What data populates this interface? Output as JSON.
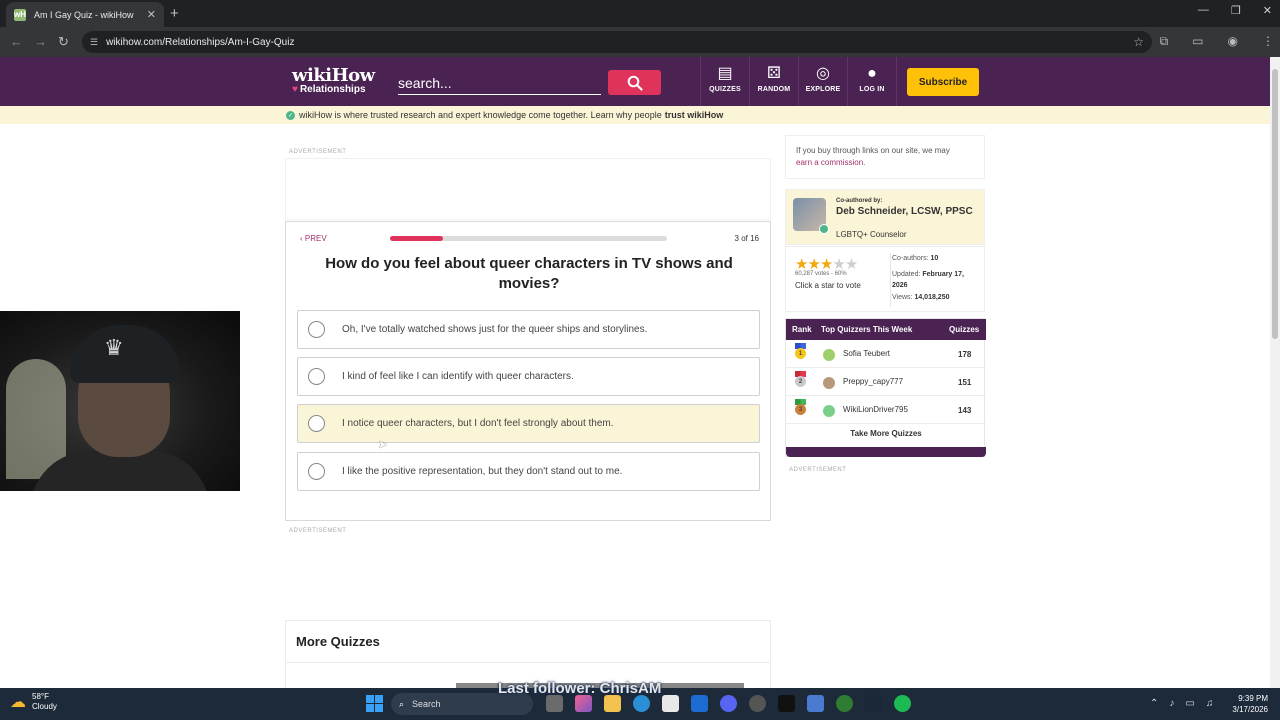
{
  "browser": {
    "tab_title": "Am I Gay Quiz - wikiHow",
    "tab_favicon": "wH",
    "url": "wikihow.com/Relationships/Am-I-Gay-Quiz"
  },
  "header": {
    "logo_main": "wikiHow",
    "logo_sub": "Relationships",
    "search_placeholder": "search...",
    "nav": [
      {
        "label": "QUIZZES",
        "icon": "quiz-icon"
      },
      {
        "label": "RANDOM",
        "icon": "dice-icon"
      },
      {
        "label": "EXPLORE",
        "icon": "compass-icon"
      },
      {
        "label": "LOG IN",
        "icon": "user-icon"
      }
    ],
    "subscribe": "Subscribe"
  },
  "trust_bar": {
    "text": "wikiHow is where trusted research and expert knowledge come together. Learn why people",
    "bold": "trust wikiHow"
  },
  "ads": {
    "label": "ADVERTISEMENT"
  },
  "quiz": {
    "prev": "PREV",
    "progress": 0.19,
    "count": "3 of 16",
    "question": "How do you feel about queer characters in TV shows and movies?",
    "options": [
      "Oh, I've totally watched shows just for the queer ships and storylines.",
      "I kind of feel like I can identify with queer characters.",
      "I notice queer characters, but I don't feel strongly about them.",
      "I like the positive representation, but they don't stand out to me."
    ]
  },
  "more_quizzes": {
    "title": "More Quizzes"
  },
  "sidebar": {
    "commission_text": "If you buy through links on our site, we may",
    "commission_link": "earn a commission.",
    "coauthored_label": "Co-authored by:",
    "author_name": "Deb Schneider, LCSW, PPSC",
    "author_role": "LGBTQ+ Counselor",
    "rating_stars": 3,
    "votes": "60,287 votes - 60%",
    "vote_cta": "Click a star to vote",
    "coauthors_label": "Co-authors:",
    "coauthors": "10",
    "updated_label": "Updated:",
    "updated": "February 17, 2026",
    "views_label": "Views:",
    "views": "14,018,250"
  },
  "leaderboard": {
    "headers": {
      "rank": "Rank",
      "title": "Top Quizzers This Week",
      "quizzes": "Quizzes"
    },
    "rows": [
      {
        "rank": "1",
        "name": "Sofia Teubert",
        "score": "178"
      },
      {
        "rank": "2",
        "name": "Preppy_capy777",
        "score": "151"
      },
      {
        "rank": "3",
        "name": "WikiLionDriver795",
        "score": "143"
      }
    ],
    "cta": "Take More Quizzes"
  },
  "overlay": {
    "follower": "Last follower: ChrisAM"
  },
  "taskbar": {
    "temp": "58°F",
    "weather": "Cloudy",
    "search": "Search",
    "time": "9:39 PM",
    "date": "3/17/2026"
  },
  "colors": {
    "brand": "#4a2353",
    "accent": "#e0335b",
    "highlight": "#fbf5d7",
    "subscribe": "#ffc107"
  }
}
